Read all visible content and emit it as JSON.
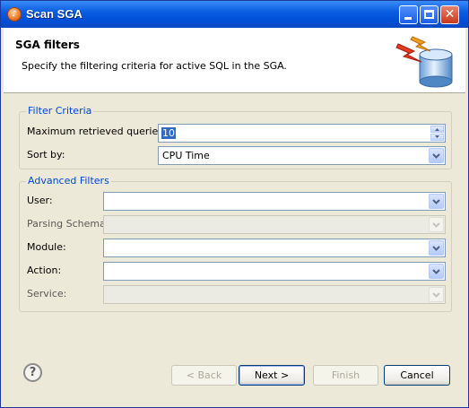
{
  "window": {
    "title": "Scan SGA"
  },
  "banner": {
    "title": "SGA filters",
    "description": "Specify the filtering criteria for active SQL in the SGA."
  },
  "filter_criteria": {
    "legend": "Filter Criteria",
    "max_queries_label": "Maximum retrieved queries:",
    "max_queries_value": "10",
    "sort_by_label": "Sort by:",
    "sort_by_value": "CPU Time"
  },
  "advanced_filters": {
    "legend": "Advanced Filters",
    "user_label": "User:",
    "user_value": "",
    "parsing_schema_label": "Parsing Schema:",
    "parsing_schema_value": "",
    "module_label": "Module:",
    "module_value": "",
    "action_label": "Action:",
    "action_value": "",
    "service_label": "Service:",
    "service_value": ""
  },
  "buttons": {
    "back": "< Back",
    "next": "Next >",
    "finish": "Finish",
    "cancel": "Cancel"
  },
  "states": {
    "back_enabled": false,
    "next_enabled": true,
    "finish_enabled": false,
    "parsing_schema_enabled": false,
    "service_enabled": false
  },
  "colors": {
    "accent": "#0046d5",
    "titlebar": "#0054e3",
    "dialog_bg": "#ece9d8",
    "selection": "#316ac5"
  },
  "icons": [
    "app-icon",
    "minimize-icon",
    "maximize-icon",
    "close-icon",
    "sga-database-icon",
    "info-icon",
    "spin-up-icon",
    "spin-down-icon",
    "chevron-down-icon",
    "help-icon"
  ]
}
